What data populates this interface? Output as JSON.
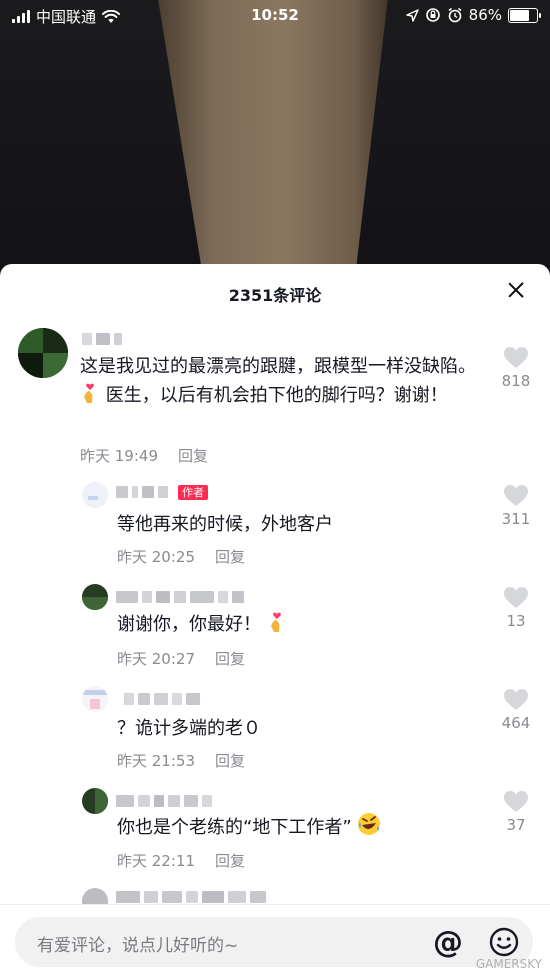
{
  "status_bar": {
    "carrier": "中国联通",
    "time": "10:52",
    "battery": "86%",
    "battery_level": 0.86
  },
  "sheet": {
    "title": "2351条评论"
  },
  "comments": [
    {
      "text": "这是我见过的最漂亮的跟腱，跟模型一样没缺陷。",
      "text_after_emoji": "医生，以后有机会拍下他的脚行吗？谢谢！",
      "time": "昨天 19:49",
      "reply": "回复",
      "likes": "818"
    },
    {
      "author_tag": "作者",
      "text": "等他再来的时候，外地客户",
      "time": "昨天 20:25",
      "reply": "回复",
      "likes": "311"
    },
    {
      "text": "谢谢你，你最好！",
      "time": "昨天 20:27",
      "reply": "回复",
      "likes": "13"
    },
    {
      "text": "？诡计多端的老０",
      "time": "昨天 21:53",
      "reply": "回复",
      "likes": "464"
    },
    {
      "text": "你也是个老练的“地下工作者”",
      "time": "昨天 22:11",
      "reply": "回复",
      "likes": "37"
    }
  ],
  "input": {
    "placeholder": "有爱评论，说点儿好听的~"
  },
  "icons": {
    "at": "@",
    "heart": "heart-icon",
    "close": "close-icon",
    "emoji": "smile-icon"
  },
  "watermark": "GAMERSKY",
  "colors": {
    "author_tag": "#fe2c55",
    "meta": "#8a8b91",
    "text": "#161823"
  }
}
